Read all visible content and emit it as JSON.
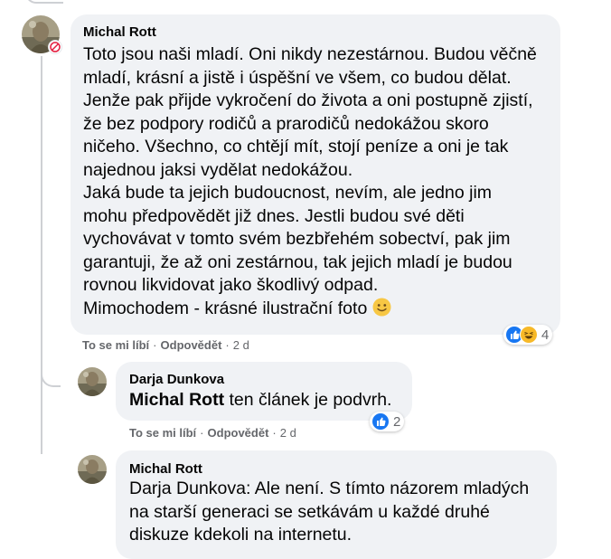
{
  "comments": [
    {
      "author": "Michal Rott",
      "lines": [
        "Toto jsou naši mladí. Oni nikdy nezestárnou. Budou věčně",
        "mladí, krásní a jistě i úspěšní ve všem, co budou dělat.",
        "Jenže pak přijde vykročení do života a oni postupně zjistí,",
        "že bez podpory rodičů a prarodičů nedokážou skoro",
        "ničeho. Všechno, co chtějí mít, stojí peníze a oni je tak",
        "najednou jaksi vydělat nedokážou.",
        "Jaká bude ta jejich budoucnost, nevím, ale jedno jim",
        "mohu předpovědět již dnes. Jestli budou své děti",
        "vychovávat v tomto svém bezbřehém sobectví, pak jim",
        "garantuji, že až oni zestárnou, tak jejich mladí je budou",
        "rovnou likvidovat jako škodlivý odpad.",
        "Mimochodem - krásné ilustrační foto"
      ],
      "emoji": "slightly-smiling-face-icon",
      "actions": {
        "like": "To se mi líbí",
        "reply": "Odpovědět",
        "time": "2 d"
      },
      "reactions": {
        "icons": [
          "like-reaction-icon",
          "haha-reaction-icon"
        ],
        "count": "4"
      }
    },
    {
      "author": "Darja Dunkova",
      "mention": "Michal Rott",
      "text": " ten článek je podvrh.",
      "actions": {
        "like": "To se mi líbí",
        "reply": "Odpovědět",
        "time": "2 d"
      },
      "reactions": {
        "icons": [
          "like-reaction-icon"
        ],
        "count": "2"
      }
    },
    {
      "author": "Michal Rott",
      "lines": [
        "Darja Dunkova: Ale není. S tímto názorem mladých",
        "na starší generaci se setkávám u každé druhé",
        "diskuze kdekoli na internetu."
      ]
    }
  ],
  "colors": {
    "bubble": "#f0f2f5",
    "meta_text": "#65676b",
    "like_blue": "#1877f2",
    "haha_yellow": "#f7b928"
  }
}
